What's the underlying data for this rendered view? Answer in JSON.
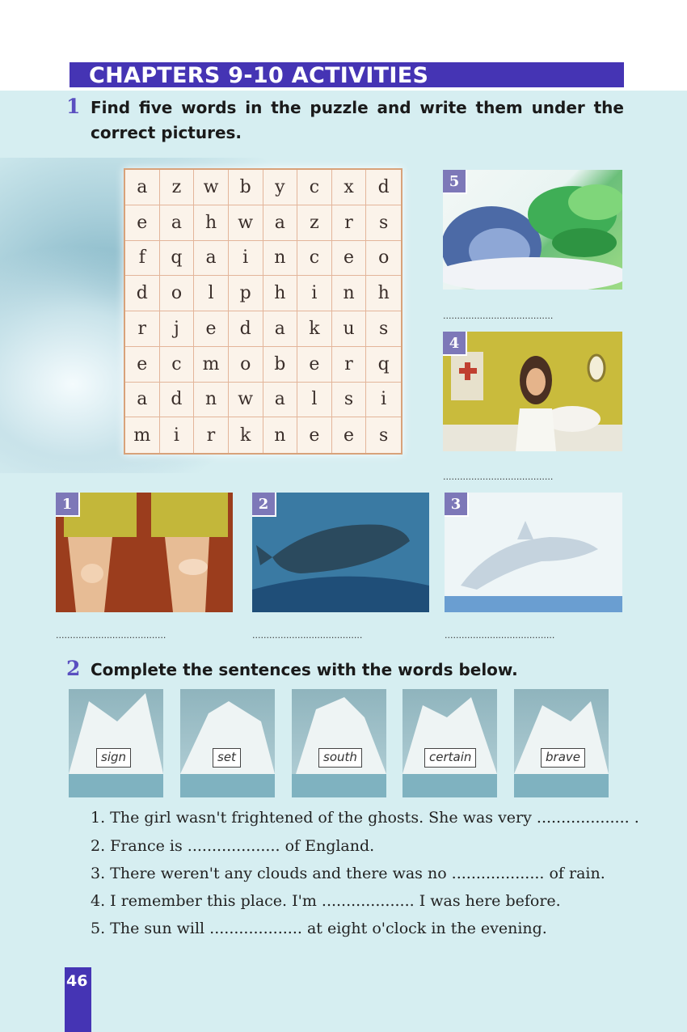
{
  "header": {
    "title": "CHAPTERS 9-10 ACTIVITIES"
  },
  "exercise1": {
    "number": "1",
    "instruction": "Find five words in the puzzle and write them under the correct pictures.",
    "puzzle": [
      [
        "a",
        "z",
        "w",
        "b",
        "y",
        "c",
        "x",
        "d"
      ],
      [
        "e",
        "a",
        "h",
        "w",
        "a",
        "z",
        "r",
        "s"
      ],
      [
        "f",
        "q",
        "a",
        "i",
        "n",
        "c",
        "e",
        "o"
      ],
      [
        "d",
        "o",
        "l",
        "p",
        "h",
        "i",
        "n",
        "h"
      ],
      [
        "r",
        "j",
        "e",
        "d",
        "a",
        "k",
        "u",
        "s"
      ],
      [
        "e",
        "c",
        "m",
        "o",
        "b",
        "e",
        "r",
        "q"
      ],
      [
        "a",
        "d",
        "n",
        "w",
        "a",
        "l",
        "s",
        "i"
      ],
      [
        "m",
        "i",
        "r",
        "k",
        "n",
        "e",
        "e",
        "s"
      ]
    ],
    "pictures": [
      {
        "number": "5",
        "icon": "sleeping-girl-dream-image"
      },
      {
        "number": "4",
        "icon": "nurse-hospital-image"
      },
      {
        "number": "1",
        "icon": "knees-image"
      },
      {
        "number": "2",
        "icon": "whale-image"
      },
      {
        "number": "3",
        "icon": "dolphin-image"
      }
    ],
    "answer_line": "......................................."
  },
  "exercise2": {
    "number": "2",
    "instruction": "Complete the sentences with the words below.",
    "words": [
      "sign",
      "set",
      "south",
      "certain",
      "brave"
    ],
    "sentences": [
      "1. The girl wasn't frightened of the ghosts. She was very ................... .",
      "2. France is ................... of England.",
      "3. There weren't any clouds and there was no ................... of rain.",
      "4. I remember this place. I'm ................... I was here before.",
      "5. The sun will ................... at eight o'clock in the evening."
    ]
  },
  "footer": {
    "page_number": "46"
  },
  "colors": {
    "accent": "#4534b4",
    "background": "#d6eef1",
    "number_blue": "#5a4fc0"
  }
}
